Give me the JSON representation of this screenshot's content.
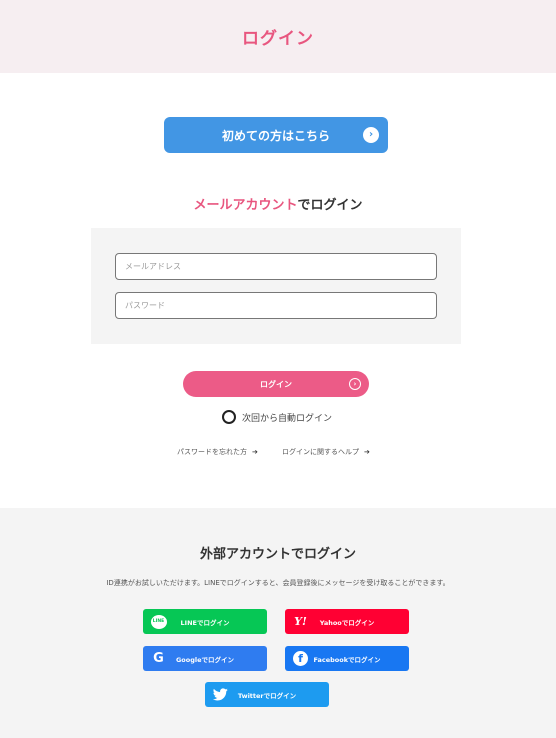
{
  "header": {
    "title": "ログイン"
  },
  "first_time": {
    "label": "初めての方はこちら",
    "icon": "chevron-right-circle-icon"
  },
  "mail_login": {
    "title_accent": "メールアカウント",
    "title_rest": "でログイン"
  },
  "form": {
    "email_placeholder": "メールアドレス",
    "password_placeholder": "パスワード",
    "submit_label": "ログイン",
    "auto_login_label": "次回から自動ログイン",
    "auto_login_checked": false
  },
  "links": {
    "forgot_password": "パスワードを忘れた方",
    "help": "ログインに関するヘルプ"
  },
  "external": {
    "title": "外部アカウントでログイン",
    "note": "ID連携がお試しいただけます。LINEでログインすると、会員登録後にメッセージを受け取ることができます。",
    "buttons": {
      "line": {
        "label": "LINEでログイン",
        "icon_text": "LINE",
        "color": "#06c755"
      },
      "yahoo": {
        "label": "Yahooでログイン",
        "icon_text": "Y!",
        "color": "#ff0033"
      },
      "google": {
        "label": "Googleでログイン",
        "icon_text": "G",
        "color": "#2f7cf0"
      },
      "facebook": {
        "label": "Facebookでログイン",
        "icon_text": "f",
        "color": "#1877f2"
      },
      "twitter": {
        "label": "Twitterでログイン",
        "color": "#1d9bf0"
      }
    }
  },
  "colors": {
    "accent_pink": "#e8567f",
    "primary_blue": "#4296e4",
    "login_pink": "#ec5b87"
  }
}
